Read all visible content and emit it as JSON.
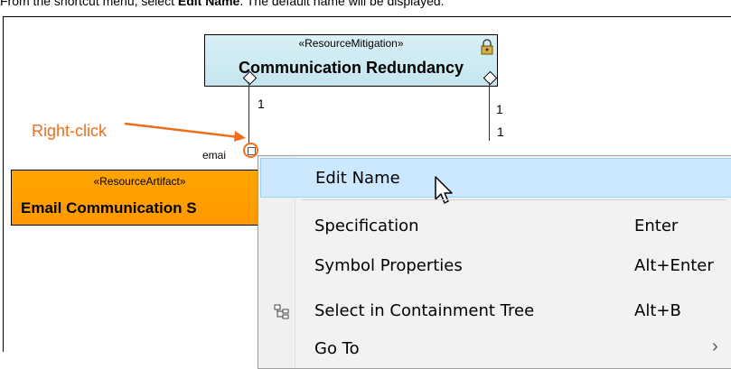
{
  "caption": {
    "prefix": "From the shortcut menu, select ",
    "emphasis": "Edit Name",
    "suffix": ". The default name will be displayed."
  },
  "diagram": {
    "mitigation_block": {
      "stereotype": "«ResourceMitigation»",
      "name": "Communication Redundancy"
    },
    "multiplicity_left": "1",
    "multiplicity_right": "1",
    "multiplicity_right_lower": "1",
    "right_click_label": "Right-click",
    "port_label": "emai",
    "artifact_block": {
      "stereotype": "«ResourceArtifact»",
      "name": "Email Communication S"
    },
    "colors": {
      "accent": "#ee6e1c",
      "artifact_fill": "#ffa500",
      "block_fill": "#cdeaf2"
    }
  },
  "context_menu": {
    "items": [
      {
        "label": "Edit Name",
        "shortcut": "",
        "icon": "",
        "hovered": true
      },
      {
        "label": "Specification",
        "shortcut": "Enter",
        "icon": ""
      },
      {
        "label": "Symbol Properties",
        "shortcut": "Alt+Enter",
        "icon": ""
      },
      {
        "label": "Select in Containment Tree",
        "shortcut": "Alt+B",
        "icon": "containment-tree-icon"
      },
      {
        "label": "Go To",
        "shortcut": "",
        "icon": "",
        "submenu": true
      }
    ],
    "hover_color": "#cce8ff"
  }
}
